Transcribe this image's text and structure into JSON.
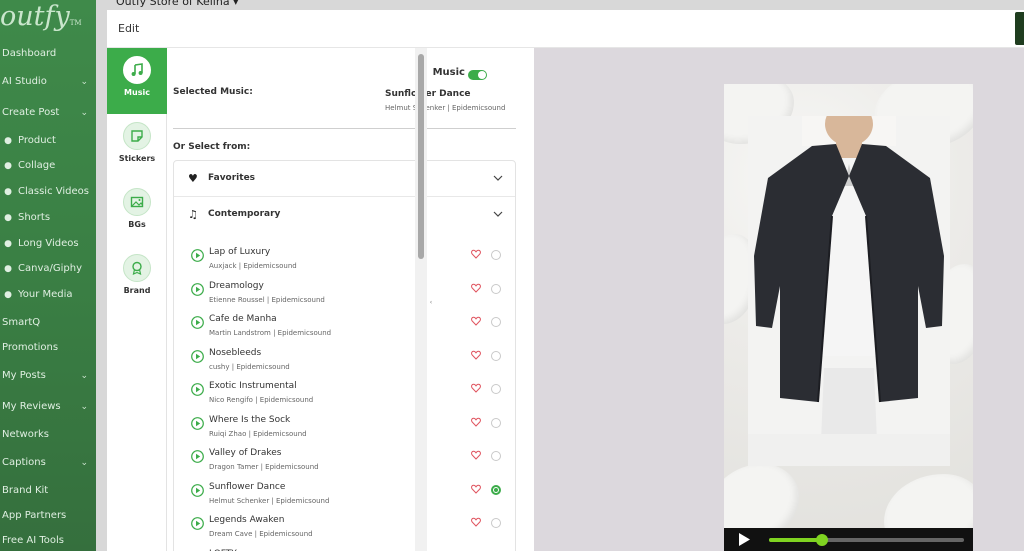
{
  "app": {
    "logo": "outfy",
    "logo_mark": "TM",
    "store_name": "Outfy Store of Kelina ▾"
  },
  "sidebar": {
    "items": [
      {
        "label": "Dashboard",
        "icon": "",
        "chevron": false
      },
      {
        "label": "AI Studio",
        "icon": "",
        "chevron": true
      },
      {
        "label": "Create Post",
        "icon": "",
        "chevron": true
      },
      {
        "label": "Product",
        "icon": "shirt-icon",
        "chevron": false
      },
      {
        "label": "Collage",
        "icon": "collage-icon",
        "chevron": false
      },
      {
        "label": "Classic Videos",
        "icon": "play-icon",
        "chevron": false
      },
      {
        "label": "Shorts",
        "icon": "shorts-icon",
        "chevron": false
      },
      {
        "label": "Long Videos",
        "icon": "video-icon",
        "chevron": false
      },
      {
        "label": "Canva/Giphy",
        "icon": "canva-icon",
        "chevron": false
      },
      {
        "label": "Your Media",
        "icon": "share-icon",
        "chevron": false
      },
      {
        "label": "SmartQ",
        "icon": "",
        "chevron": false
      },
      {
        "label": "Promotions",
        "icon": "",
        "chevron": false
      },
      {
        "label": "My Posts",
        "icon": "",
        "chevron": true
      },
      {
        "label": "My Reviews",
        "icon": "",
        "chevron": true
      },
      {
        "label": "Networks",
        "icon": "",
        "chevron": false
      },
      {
        "label": "Captions",
        "icon": "",
        "chevron": true
      },
      {
        "label": "Brand Kit",
        "icon": "",
        "chevron": false
      },
      {
        "label": "App Partners",
        "icon": "",
        "chevron": false
      },
      {
        "label": "Free AI Tools",
        "icon": "",
        "chevron": false
      }
    ]
  },
  "modal": {
    "title": "Edit"
  },
  "tool_tabs": [
    {
      "label": "Music",
      "icon": "music-note-icon",
      "active": true
    },
    {
      "label": "Stickers",
      "icon": "sticker-icon",
      "active": false
    },
    {
      "label": "BGs",
      "icon": "image-icon",
      "active": false
    },
    {
      "label": "Brand",
      "icon": "badge-icon",
      "active": false
    }
  ],
  "music": {
    "toggle_label": "Music",
    "toggle_on": true,
    "selected_label": "Selected Music:",
    "selected_title": "Sunflower Dance",
    "selected_artist": "Helmut Schenker | Epidemicsound",
    "select_from_label": "Or Select from:",
    "categories": [
      {
        "label": "Favorites",
        "icon": "heart-icon",
        "expanded": false
      },
      {
        "label": "Contemporary",
        "icon": "music-note-icon",
        "expanded": true
      }
    ],
    "tracks": [
      {
        "title": "Lap of Luxury",
        "artist": "Auxjack | Epidemicsound",
        "selected": false
      },
      {
        "title": "Dreamology",
        "artist": "Etienne Roussel | Epidemicsound",
        "selected": false
      },
      {
        "title": "Cafe de Manha",
        "artist": "Martin Landstrom | Epidemicsound",
        "selected": false
      },
      {
        "title": "Nosebleeds",
        "artist": "cushy | Epidemicsound",
        "selected": false
      },
      {
        "title": "Exotic Instrumental",
        "artist": "Nico Rengifo | Epidemicsound",
        "selected": false
      },
      {
        "title": "Where Is the Sock",
        "artist": "Ruiqi Zhao | Epidemicsound",
        "selected": false
      },
      {
        "title": "Valley of Drakes",
        "artist": "Dragon Tamer | Epidemicsound",
        "selected": false
      },
      {
        "title": "Sunflower Dance",
        "artist": "Helmut Schenker | Epidemicsound",
        "selected": true
      },
      {
        "title": "Legends Awaken",
        "artist": "Dream Cave | Epidemicsound",
        "selected": false
      },
      {
        "title": "LOFTY",
        "artist": "",
        "selected": false
      }
    ]
  },
  "preview": {
    "progress": 0.27
  },
  "colors": {
    "accent": "#3cac4a",
    "heart": "#e05560",
    "progress": "#7fd321"
  }
}
